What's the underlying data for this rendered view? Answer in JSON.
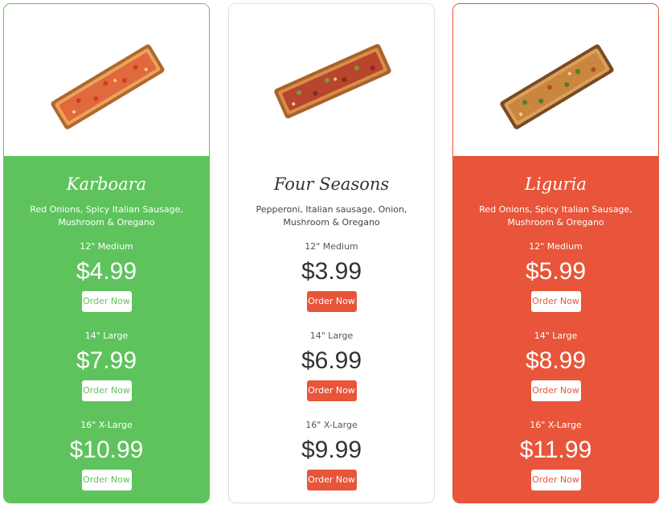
{
  "colors": {
    "green": "#5ec35c",
    "red": "#e8553a",
    "white": "#ffffff",
    "dark_text": "#333333"
  },
  "pizzas": [
    {
      "name": "Karboara",
      "description": "Red Onions, Spicy Italian Sausage, Mushroom & Oregano",
      "image_icon": "pizza-image",
      "sizes": [
        {
          "label": "12\" Medium",
          "price": "$4.99",
          "button": "Order Now"
        },
        {
          "label": "14\" Large",
          "price": "$7.99",
          "button": "Order Now"
        },
        {
          "label": "16\" X-Large",
          "price": "$10.99",
          "button": "Order Now"
        }
      ]
    },
    {
      "name": "Four Seasons",
      "description": "Pepperoni, Italian sausage, Onion, Mushroom & Oregano",
      "image_icon": "pizza-image",
      "sizes": [
        {
          "label": "12\" Medium",
          "price": "$3.99",
          "button": "Order Now"
        },
        {
          "label": "14\" Large",
          "price": "$6.99",
          "button": "Order Now"
        },
        {
          "label": "16\" X-Large",
          "price": "$9.99",
          "button": "Order Now"
        }
      ]
    },
    {
      "name": "Liguria",
      "description": "Red Onions, Spicy Italian Sausage, Mushroom & Oregano",
      "image_icon": "pizza-image",
      "sizes": [
        {
          "label": "12\" Medium",
          "price": "$5.99",
          "button": "Order Now"
        },
        {
          "label": "14\" Large",
          "price": "$8.99",
          "button": "Order Now"
        },
        {
          "label": "16\" X-Large",
          "price": "$11.99",
          "button": "Order Now"
        }
      ]
    }
  ]
}
